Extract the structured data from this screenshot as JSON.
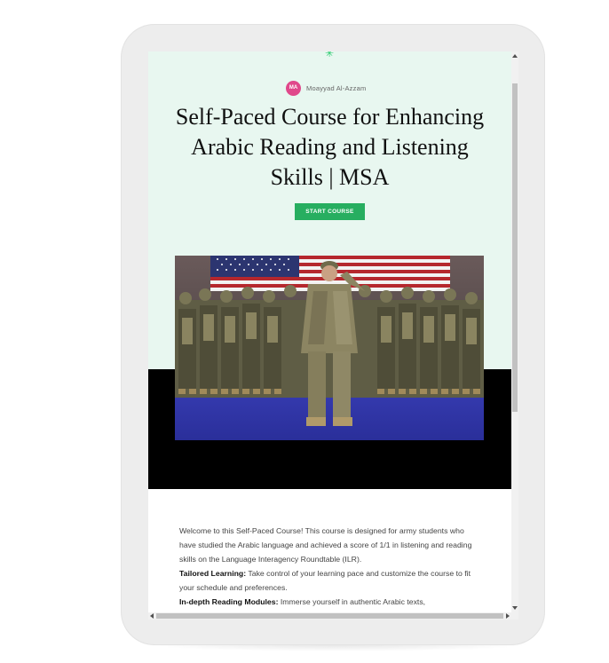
{
  "course": {
    "author_initials": "MA",
    "author_name": "Moayyad Al-Azzam",
    "title": "Self-Paced Course for Enhancing Arabic Reading and Listening Skills | MSA",
    "start_button_label": "START COURSE"
  },
  "content": {
    "intro": "Welcome to this Self-Paced Course! This course is designed for army students who have studied the Arabic language and achieved a score of 1/1 in listening and reading skills on the Language Interagency Roundtable (ILR).",
    "features": [
      {
        "label": "Tailored Learning:",
        "text": " Take control of your learning pace and customize the course to fit your schedule and preferences."
      },
      {
        "label": "In-depth Reading Modules:",
        "text": " Immerse yourself in authentic Arabic texts,"
      }
    ]
  },
  "icons": {
    "sparkle": "sparkle-icon",
    "avatar": "avatar-initials"
  },
  "colors": {
    "hero_background": "#e8f7f0",
    "accent_green": "#27ae60",
    "avatar_pink": "#e0488b",
    "hero_band": "#000000"
  }
}
